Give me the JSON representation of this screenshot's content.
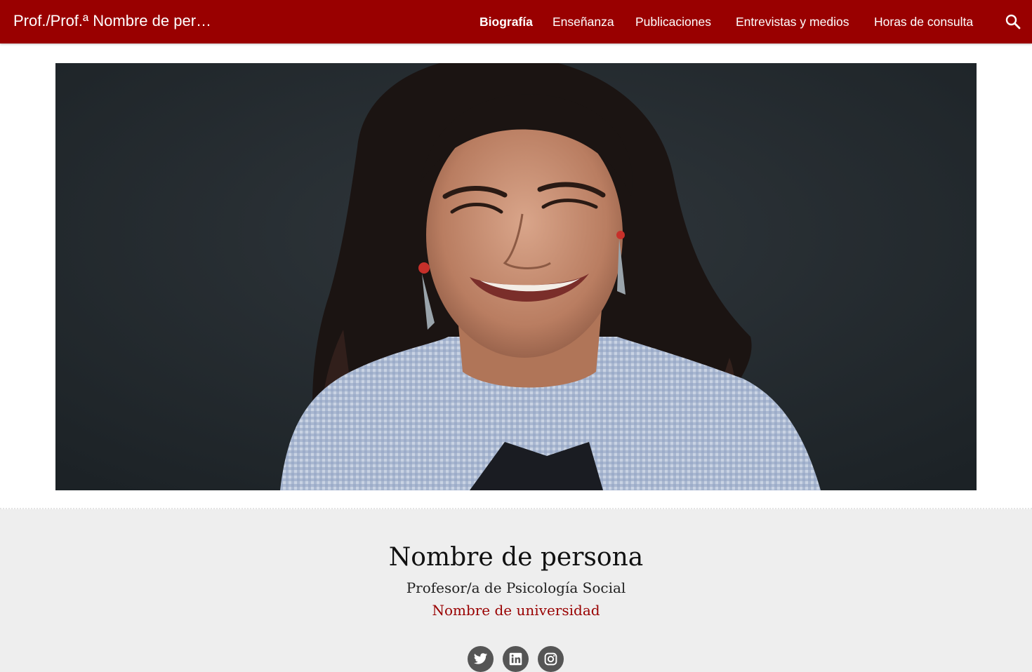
{
  "header": {
    "site_title": "Prof./Prof.ª Nombre de per…",
    "brand_color": "#990000",
    "nav": [
      {
        "label": "Biografía",
        "active": true
      },
      {
        "label": "Enseñanza",
        "active": false
      },
      {
        "label": "Publicaciones",
        "active": false
      },
      {
        "label": "Entrevistas y medios",
        "active": false
      },
      {
        "label": "Horas de consulta",
        "active": false
      }
    ],
    "search_icon": "search-icon"
  },
  "hero": {
    "image": "portrait-photo"
  },
  "profile": {
    "name": "Nombre de persona",
    "role": "Profesor/a de Psicología Social",
    "university": "Nombre de universidad",
    "social": [
      {
        "icon": "twitter-icon"
      },
      {
        "icon": "linkedin-icon"
      },
      {
        "icon": "instagram-icon"
      }
    ]
  }
}
